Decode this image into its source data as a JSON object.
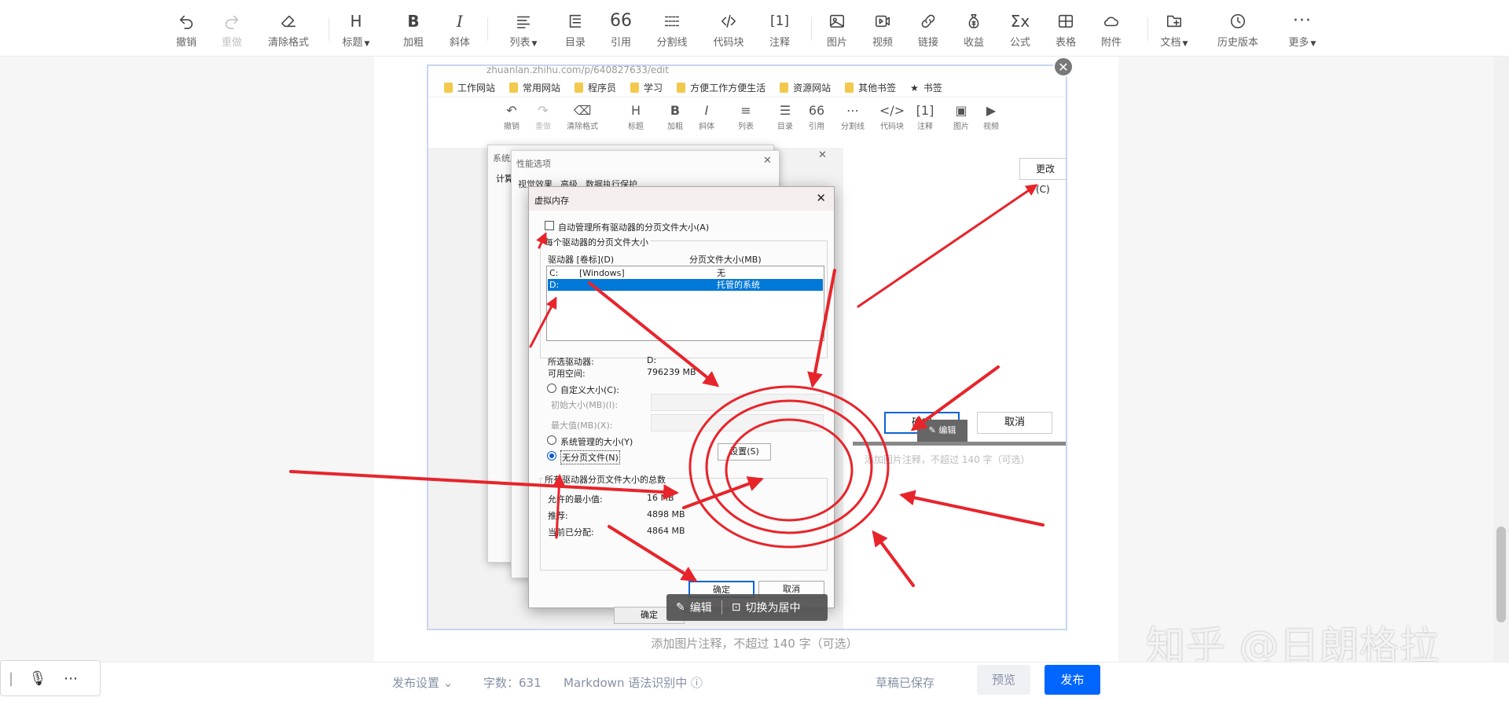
{
  "toolbar": {
    "undo": "撤销",
    "redo": "重做",
    "clear_format": "清除格式",
    "heading": "标题",
    "bold": "加粗",
    "italic": "斜体",
    "list": "列表",
    "toc": "目录",
    "quote": "引用",
    "divider": "分割线",
    "code_block": "代码块",
    "note": "注释",
    "image": "图片",
    "video": "视频",
    "link": "链接",
    "earnings": "收益",
    "formula": "公式",
    "table": "表格",
    "attachment": "附件",
    "document": "文档",
    "history": "历史版本",
    "more": "更多"
  },
  "screenshot": {
    "url": "zhuanlan.zhihu.com/p/640827633/edit",
    "bookmarks": [
      "工作网站",
      "常用网站",
      "程序员",
      "学习",
      "方便工作方便生活",
      "资源网站",
      "其他书签"
    ],
    "bookmark_star": "书签",
    "inner_toolbar": [
      "撤销",
      "重做",
      "清除格式",
      "标题",
      "加粗",
      "斜体",
      "列表",
      "目录",
      "引用",
      "分割线",
      "代码块",
      "注释",
      "图片",
      "视频"
    ],
    "change_button": "更改(C)",
    "back_ok": "确定",
    "back_cancel": "取消",
    "back_caption": "添加图片注释，不超过 140 字（可选）",
    "back_edit": "编辑",
    "sys_dialog": {
      "title": "系统属",
      "tab": "计算"
    },
    "perf_dialog": {
      "title": "性能选项",
      "tabs": [
        "视觉效果",
        "高级",
        "数据执行保护"
      ]
    },
    "vm_dialog": {
      "title": "虚拟内存",
      "auto_manage": "自动管理所有驱动器的分页文件大小(A)",
      "per_drive_group": "每个驱动器的分页文件大小",
      "col_drive": "驱动器 [卷标](D)",
      "col_size": "分页文件大小(MB)",
      "drives": [
        {
          "drive": "C:",
          "label": "[Windows]",
          "size": "无"
        },
        {
          "drive": "D:",
          "label": "",
          "size": "托管的系统"
        }
      ],
      "selected_drive_label": "所选驱动器:",
      "selected_drive_value": "D:",
      "free_space_label": "可用空间:",
      "free_space_value": "796239 MB",
      "custom_size": "自定义大小(C):",
      "initial_size": "初始大小(MB)(I):",
      "max_size": "最大值(MB)(X):",
      "system_managed": "系统管理的大小(Y)",
      "no_paging": "无分页文件(N)",
      "set_button": "设置(S)",
      "total_group": "所有驱动器分页文件大小的总数",
      "min_allowed_label": "允许的最小值:",
      "min_allowed_value": "16 MB",
      "recommended_label": "推荐:",
      "recommended_value": "4898 MB",
      "allocated_label": "当前已分配:",
      "allocated_value": "4864 MB",
      "ok": "确定",
      "cancel": "取消"
    },
    "bottom_ok": "确定",
    "edit_bar": {
      "edit": "编辑",
      "center": "切换为居中"
    }
  },
  "image_caption": "添加图片注释，不超过 140 字（可选）",
  "bottom_bar": {
    "publish_settings": "发布设置",
    "word_count": "字数：631",
    "markdown": "Markdown 语法识别中",
    "draft_saved": "草稿已保存",
    "preview": "预览",
    "publish": "发布"
  },
  "watermark": "知乎 @日朗格拉",
  "colors": {
    "publish_blue": "#0066ff",
    "annotation_red": "#e8242b",
    "selection_blue": "#0078d7"
  }
}
